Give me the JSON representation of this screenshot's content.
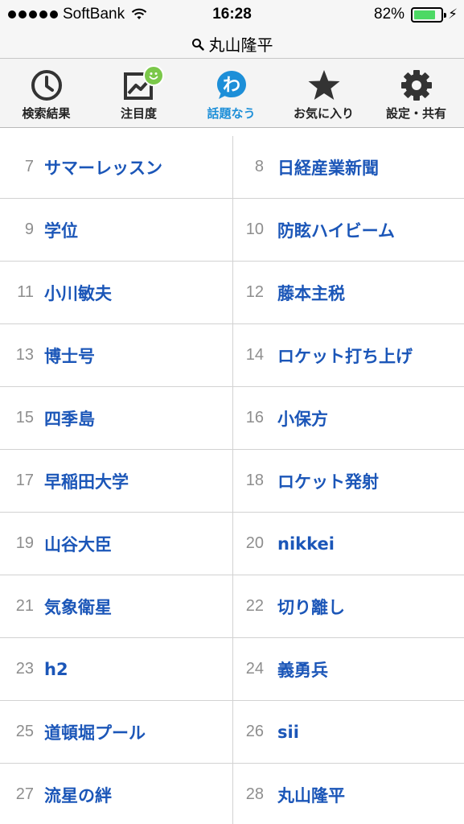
{
  "status_bar": {
    "carrier": "SoftBank",
    "time": "16:28",
    "battery_percent": "82%",
    "battery_level": 0.82
  },
  "search": {
    "query": "丸山隆平"
  },
  "tabs": [
    {
      "label": "検索結果",
      "icon": "clock-icon",
      "active": false
    },
    {
      "label": "注目度",
      "icon": "trend-chart-icon",
      "active": false
    },
    {
      "label": "話題なう",
      "icon": "wa-bubble-icon",
      "active": true
    },
    {
      "label": "お気に入り",
      "icon": "star-icon",
      "active": false
    },
    {
      "label": "設定・共有",
      "icon": "gear-icon",
      "active": false
    }
  ],
  "colors": {
    "accent": "#1d8fd8",
    "term_text": "#1b56b8",
    "rank_number": "#8e8e8e",
    "badge": "#7bc84a",
    "battery": "#4cd964"
  },
  "trending": [
    {
      "left": {
        "rank": "7",
        "term": "サマーレッスン"
      },
      "right": {
        "rank": "8",
        "term": "日経産業新聞"
      }
    },
    {
      "left": {
        "rank": "9",
        "term": "学位"
      },
      "right": {
        "rank": "10",
        "term": "防眩ハイビーム"
      }
    },
    {
      "left": {
        "rank": "11",
        "term": "小川敏夫"
      },
      "right": {
        "rank": "12",
        "term": "藤本主税"
      }
    },
    {
      "left": {
        "rank": "13",
        "term": "博士号"
      },
      "right": {
        "rank": "14",
        "term": "ロケット打ち上げ"
      }
    },
    {
      "left": {
        "rank": "15",
        "term": "四季島"
      },
      "right": {
        "rank": "16",
        "term": "小保方"
      }
    },
    {
      "left": {
        "rank": "17",
        "term": "早稲田大学"
      },
      "right": {
        "rank": "18",
        "term": "ロケット発射"
      }
    },
    {
      "left": {
        "rank": "19",
        "term": "山谷大臣"
      },
      "right": {
        "rank": "20",
        "term": "nikkei"
      }
    },
    {
      "left": {
        "rank": "21",
        "term": "気象衛星"
      },
      "right": {
        "rank": "22",
        "term": "切り離し"
      }
    },
    {
      "left": {
        "rank": "23",
        "term": "h2"
      },
      "right": {
        "rank": "24",
        "term": "義勇兵"
      }
    },
    {
      "left": {
        "rank": "25",
        "term": "道頓堀プール"
      },
      "right": {
        "rank": "26",
        "term": "sii"
      }
    },
    {
      "left": {
        "rank": "27",
        "term": "流星の絆"
      },
      "right": {
        "rank": "28",
        "term": "丸山隆平"
      }
    }
  ]
}
